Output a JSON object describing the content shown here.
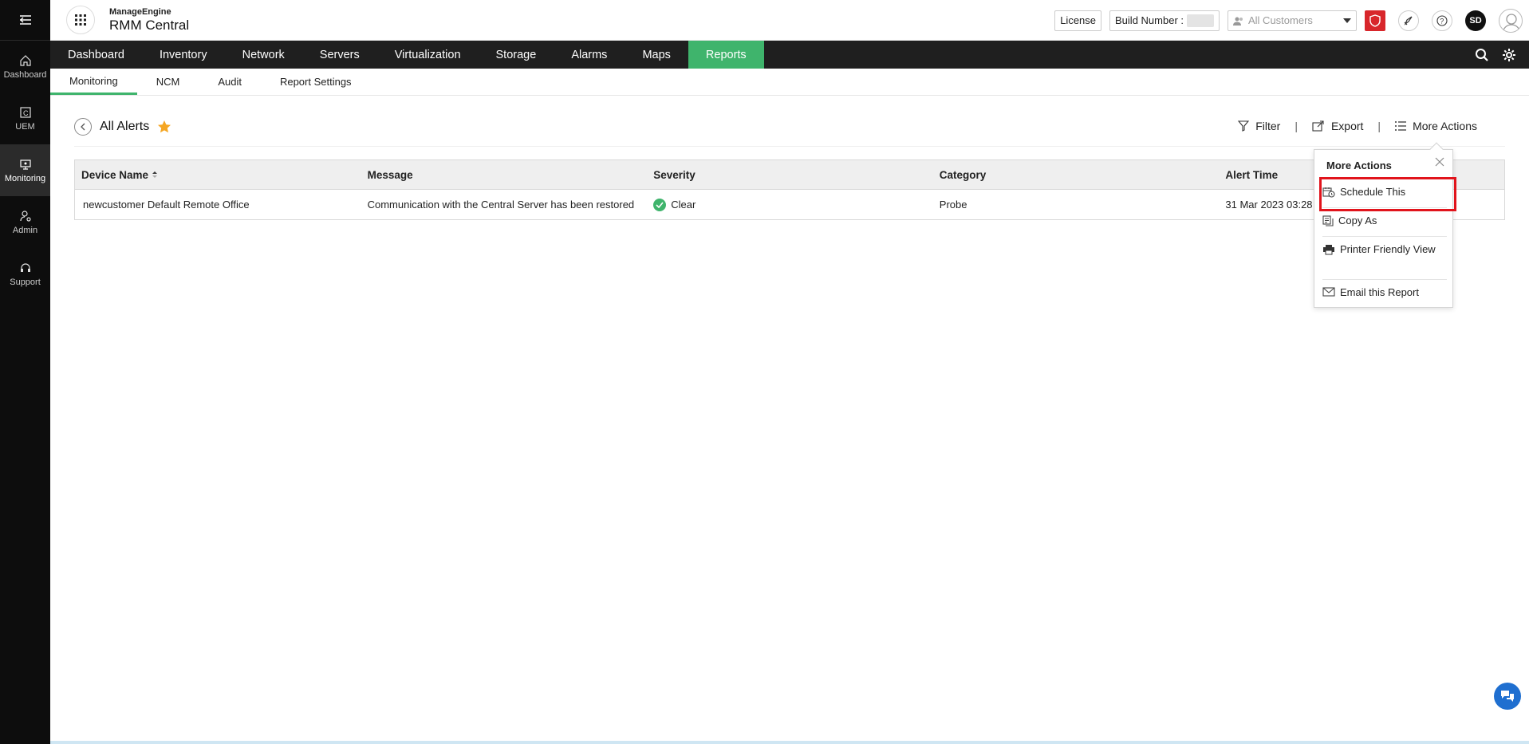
{
  "colors": {
    "accent": "#3fb46c",
    "rail_bg": "#0d0d0d",
    "nav_bg": "#1f1f1f",
    "highlight": "#e1141c",
    "shield": "#d8262b"
  },
  "left_rail": {
    "items": [
      {
        "label": "Dashboard",
        "icon": "home-icon"
      },
      {
        "label": "UEM",
        "icon": "uem-icon"
      },
      {
        "label": "Monitoring",
        "icon": "monitoring-icon"
      },
      {
        "label": "Admin",
        "icon": "admin-icon"
      },
      {
        "label": "Support",
        "icon": "headset-icon"
      }
    ]
  },
  "brand": {
    "top": "ManageEngine",
    "main": "RMM Central"
  },
  "topbar": {
    "license_label": "License",
    "build_label": "Build Number : ",
    "customer_placeholder": "All Customers",
    "user_initials": "SD"
  },
  "main_nav": [
    "Dashboard",
    "Inventory",
    "Network",
    "Servers",
    "Virtualization",
    "Storage",
    "Alarms",
    "Maps",
    "Reports"
  ],
  "main_nav_active": "Reports",
  "sub_nav": [
    "Monitoring",
    "NCM",
    "Audit",
    "Report Settings"
  ],
  "sub_nav_active": "Monitoring",
  "page": {
    "title": "All Alerts",
    "actions": {
      "filter": "Filter",
      "export": "Export",
      "more": "More Actions"
    }
  },
  "table": {
    "headers": [
      "Device Name",
      "Message",
      "Severity",
      "Category",
      "Alert Time"
    ],
    "rows": [
      {
        "device": "newcustomer Default Remote Office",
        "message": "Communication with the Central Server has been restored",
        "severity": "Clear",
        "category": "Probe",
        "alert_time": "31 Mar 2023 03:28"
      }
    ]
  },
  "popup": {
    "title": "More Actions",
    "items": [
      "Schedule This",
      "Copy As",
      "Printer Friendly View",
      "Email this Report"
    ]
  }
}
